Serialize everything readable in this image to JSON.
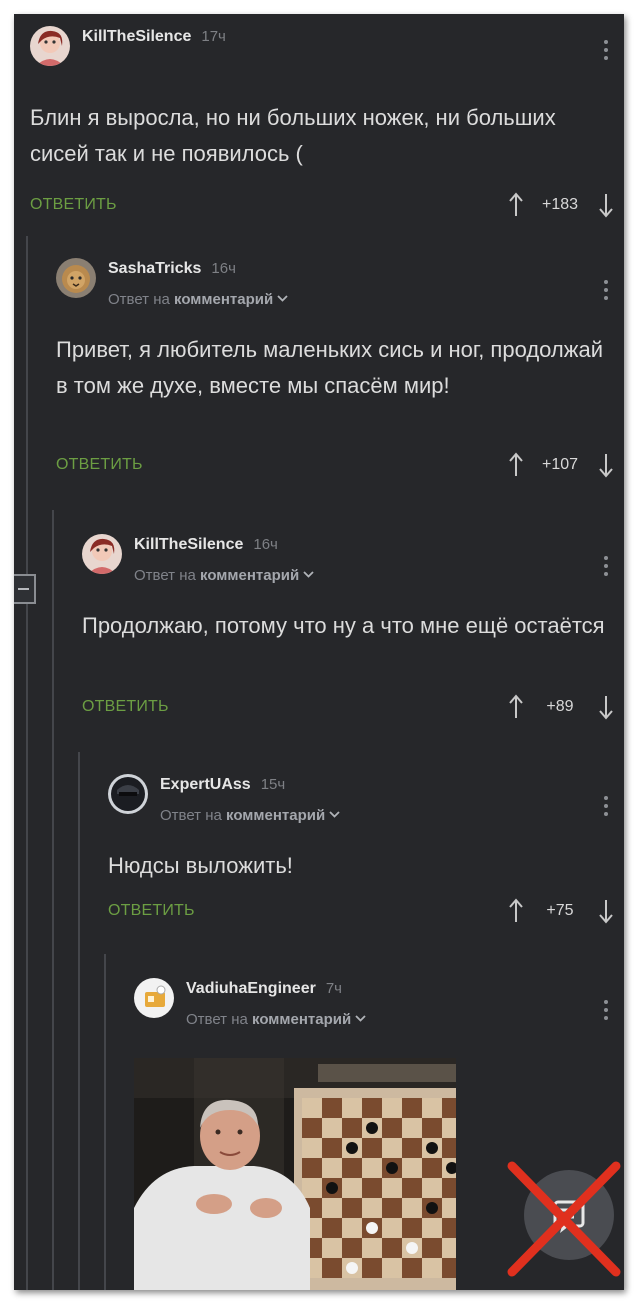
{
  "thread": {
    "comments": [
      {
        "author": "KillTheSilence",
        "time": "17ч",
        "text": "Блин я выросла, но ни больших ножек, ни больших сисей так и не появилось (",
        "reply_label": "ОТВЕТИТЬ",
        "score": "+183"
      },
      {
        "author": "SashaTricks",
        "time": "16ч",
        "reply_prefix": "Ответ на",
        "reply_target": "комментарий",
        "text": "Привет, я любитель маленьких сись и ног, продолжай в том же духе, вместе мы спасём мир!",
        "reply_label": "ОТВЕТИТЬ",
        "score": "+107"
      },
      {
        "author": "KillTheSilence",
        "time": "16ч",
        "reply_prefix": "Ответ на",
        "reply_target": "комментарий",
        "text": "Продолжаю, потому что ну а что мне ещё остаётся",
        "reply_label": "ОТВЕТИТЬ",
        "score": "+89"
      },
      {
        "author": "ExpertUAss",
        "time": "15ч",
        "reply_prefix": "Ответ на",
        "reply_target": "комментарий",
        "text": "Нюдсы выложить!",
        "reply_label": "ОТВЕТИТЬ",
        "score": "+75"
      },
      {
        "author": "VadiuhaEngineer",
        "time": "7ч",
        "reply_prefix": "Ответ на",
        "reply_target": "комментарий"
      }
    ]
  },
  "icons": {
    "upvote": "arrow-up-icon",
    "downvote": "arrow-down-icon",
    "more": "kebab-menu-icon",
    "chevron": "chevron-down-icon",
    "collapse": "collapse-minus-icon",
    "fab": "compose-icon"
  },
  "colors": {
    "background": "#26272a",
    "reply_action": "#6c9e43",
    "text": "#dcdcdc",
    "muted": "#7e8085",
    "cross": "#e0301e"
  }
}
